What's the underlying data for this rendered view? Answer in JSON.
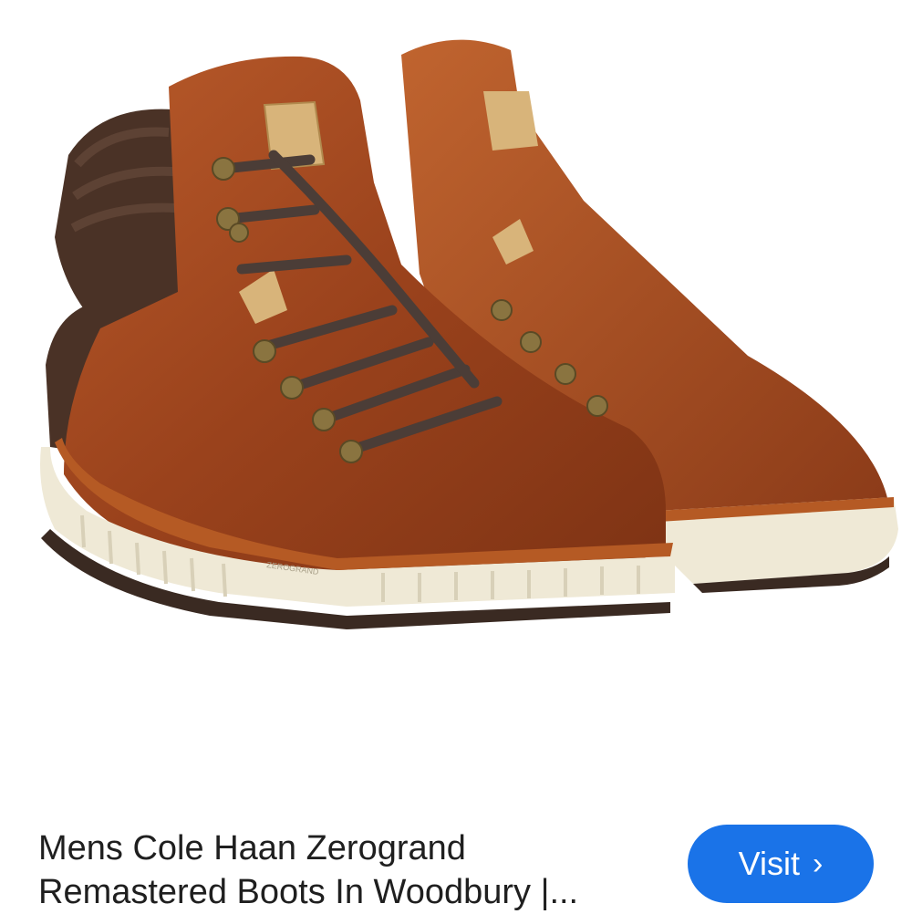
{
  "product": {
    "title_line1": "Mens Cole Haan Zerogrand",
    "title_line2": "Remastered Boots In Woodbury |...",
    "image_label": "ZEROGRAND"
  },
  "actions": {
    "visit_label": "Visit",
    "visit_icon": "chevron-right-icon",
    "visit_icon_glyph": "›"
  },
  "colors": {
    "button_bg": "#1a73e8",
    "leather": "#a24a22",
    "collar": "#4a3226",
    "sole": "#efe9d6"
  }
}
